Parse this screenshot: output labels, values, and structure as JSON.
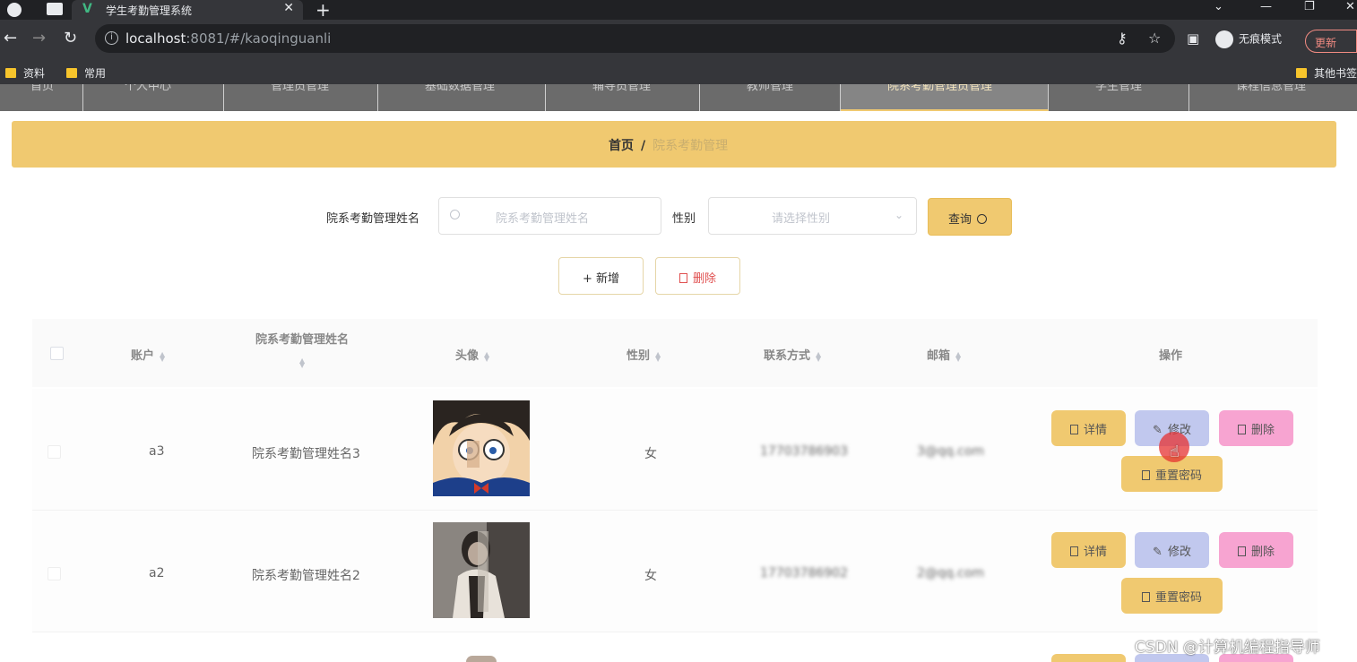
{
  "browser": {
    "tab_title": "学生考勤管理系统",
    "url_host": "localhost",
    "url_rest": ":8081/#/kaoqinguanli",
    "incognito_label": "无痕模式",
    "update_label": "更新",
    "bookmarks": [
      "资料",
      "常用"
    ],
    "other_bookmarks": "其他书签"
  },
  "nav": {
    "items": [
      "首页",
      "个人中心",
      "管理员管理",
      "基础数据管理",
      "辅导员管理",
      "教师管理",
      "院系考勤管理员管理",
      "学生管理",
      "课程信息管理"
    ],
    "active_index": 6
  },
  "breadcrumb": {
    "home": "首页",
    "sep": "/",
    "current": "院系考勤管理"
  },
  "search": {
    "name_label": "院系考勤管理姓名",
    "name_placeholder": "院系考勤管理姓名",
    "gender_label": "性别",
    "gender_placeholder": "请选择性别",
    "query_label": "查询"
  },
  "toolbar": {
    "add_label": "+ 新增",
    "delete_label": "删除"
  },
  "table": {
    "columns": [
      "账户",
      "院系考勤管理姓名",
      "头像",
      "性别",
      "联系方式",
      "邮箱",
      "操作"
    ],
    "rows": [
      {
        "account": "a3",
        "name": "院系考勤管理姓名3",
        "gender": "女",
        "phone": "17703786903",
        "email": "3@qq.com"
      },
      {
        "account": "a2",
        "name": "院系考勤管理姓名2",
        "gender": "女",
        "phone": "17703786902",
        "email": "2@qq.com"
      }
    ],
    "actions": {
      "detail": "详情",
      "edit": "修改",
      "delete": "删除",
      "reset": "重置密码"
    }
  },
  "watermark": "CSDN @计算机编程指导师",
  "colors": {
    "accent": "#f0c970",
    "edit": "#c1c8ee",
    "delete": "#f7a4d1"
  }
}
